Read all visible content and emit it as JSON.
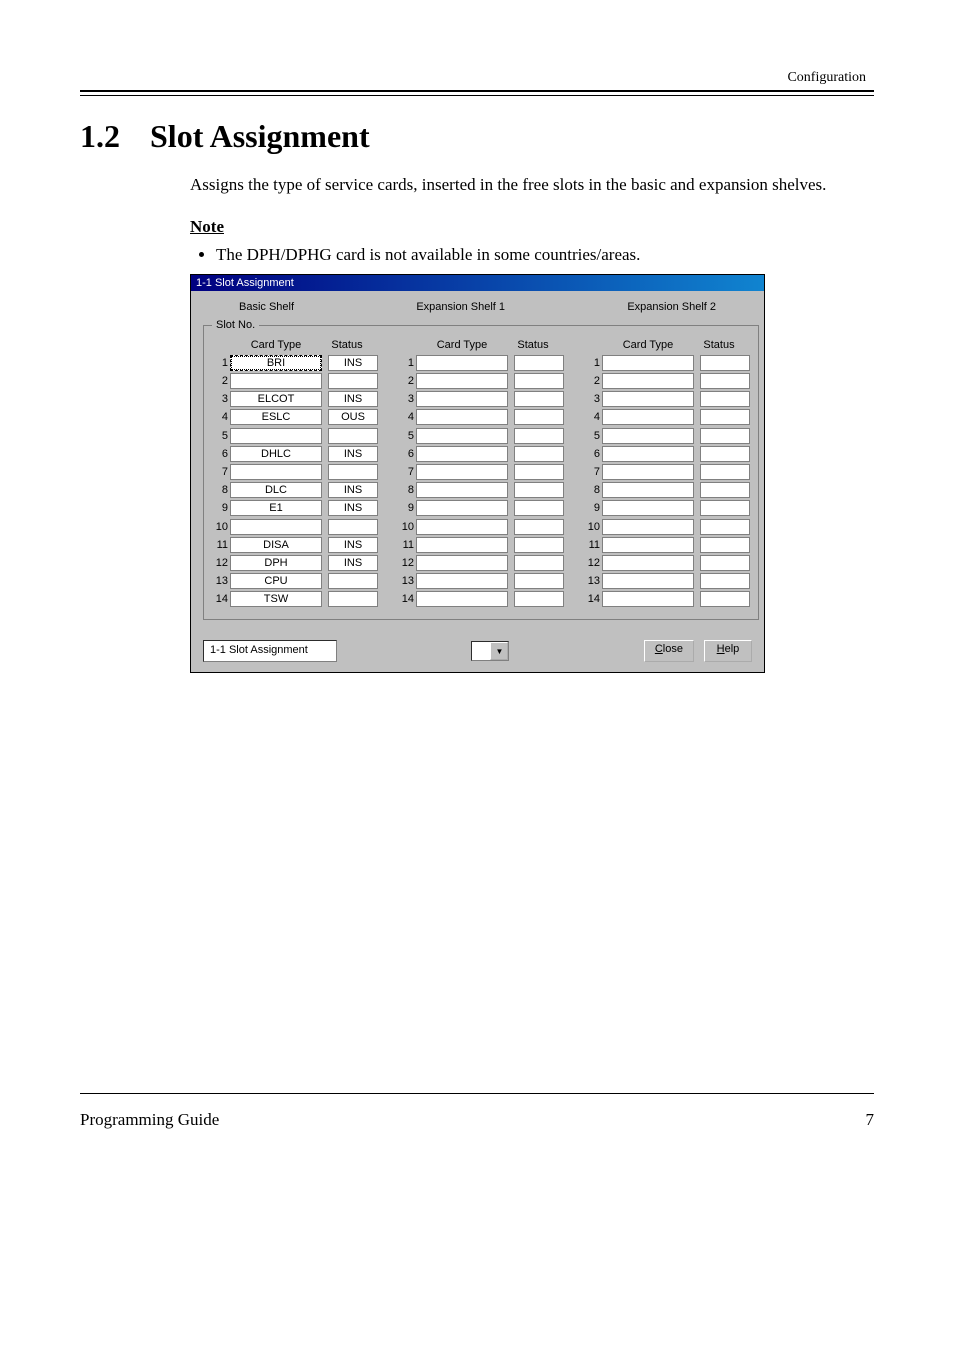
{
  "page": {
    "header_right": "Configuration",
    "section_number": "1.2",
    "section_title": "Slot Assignment",
    "intro": "Assigns the type of service cards, inserted in the free slots in the basic and expansion shelves.",
    "note_heading": "Note",
    "note_bullet": "The DPH/DPHG card is not available in some countries/areas.",
    "footer_left": "Programming Guide",
    "footer_right": "7"
  },
  "win": {
    "title": "1-1 Slot Assignment",
    "shelves": {
      "basic": "Basic Shelf",
      "exp1": "Expansion Shelf 1",
      "exp2": "Expansion Shelf 2"
    },
    "legend": "Slot No.",
    "headers": {
      "card": "Card Type",
      "status": "Status"
    },
    "basic_rows": [
      {
        "n": "1",
        "card": "BRI",
        "status": "INS"
      },
      {
        "n": "2",
        "card": "",
        "status": ""
      },
      {
        "n": "3",
        "card": "ELCOT",
        "status": "INS"
      },
      {
        "n": "4",
        "card": "ESLC",
        "status": "OUS"
      },
      {
        "n": "5",
        "card": "",
        "status": ""
      },
      {
        "n": "6",
        "card": "DHLC",
        "status": "INS"
      },
      {
        "n": "7",
        "card": "",
        "status": ""
      },
      {
        "n": "8",
        "card": "DLC",
        "status": "INS"
      },
      {
        "n": "9",
        "card": "E1",
        "status": "INS"
      },
      {
        "n": "10",
        "card": "",
        "status": ""
      },
      {
        "n": "11",
        "card": "DISA",
        "status": "INS"
      },
      {
        "n": "12",
        "card": "DPH",
        "status": "INS"
      },
      {
        "n": "13",
        "card": "CPU",
        "status": ""
      },
      {
        "n": "14",
        "card": "TSW",
        "status": ""
      }
    ],
    "exp1_rows": [
      {
        "n": "1"
      },
      {
        "n": "2"
      },
      {
        "n": "3"
      },
      {
        "n": "4"
      },
      {
        "n": "5"
      },
      {
        "n": "6"
      },
      {
        "n": "7"
      },
      {
        "n": "8"
      },
      {
        "n": "9"
      },
      {
        "n": "10"
      },
      {
        "n": "11"
      },
      {
        "n": "12"
      },
      {
        "n": "13"
      },
      {
        "n": "14"
      }
    ],
    "exp2_rows": [
      {
        "n": "1"
      },
      {
        "n": "2"
      },
      {
        "n": "3"
      },
      {
        "n": "4"
      },
      {
        "n": "5"
      },
      {
        "n": "6"
      },
      {
        "n": "7"
      },
      {
        "n": "8"
      },
      {
        "n": "9"
      },
      {
        "n": "10"
      },
      {
        "n": "11"
      },
      {
        "n": "12"
      },
      {
        "n": "13"
      },
      {
        "n": "14"
      }
    ],
    "nav_field": "1-1 Slot Assignment",
    "buttons": {
      "close_pre": "C",
      "close_rest": "lose",
      "help_pre": "H",
      "help_rest": "elp"
    }
  }
}
